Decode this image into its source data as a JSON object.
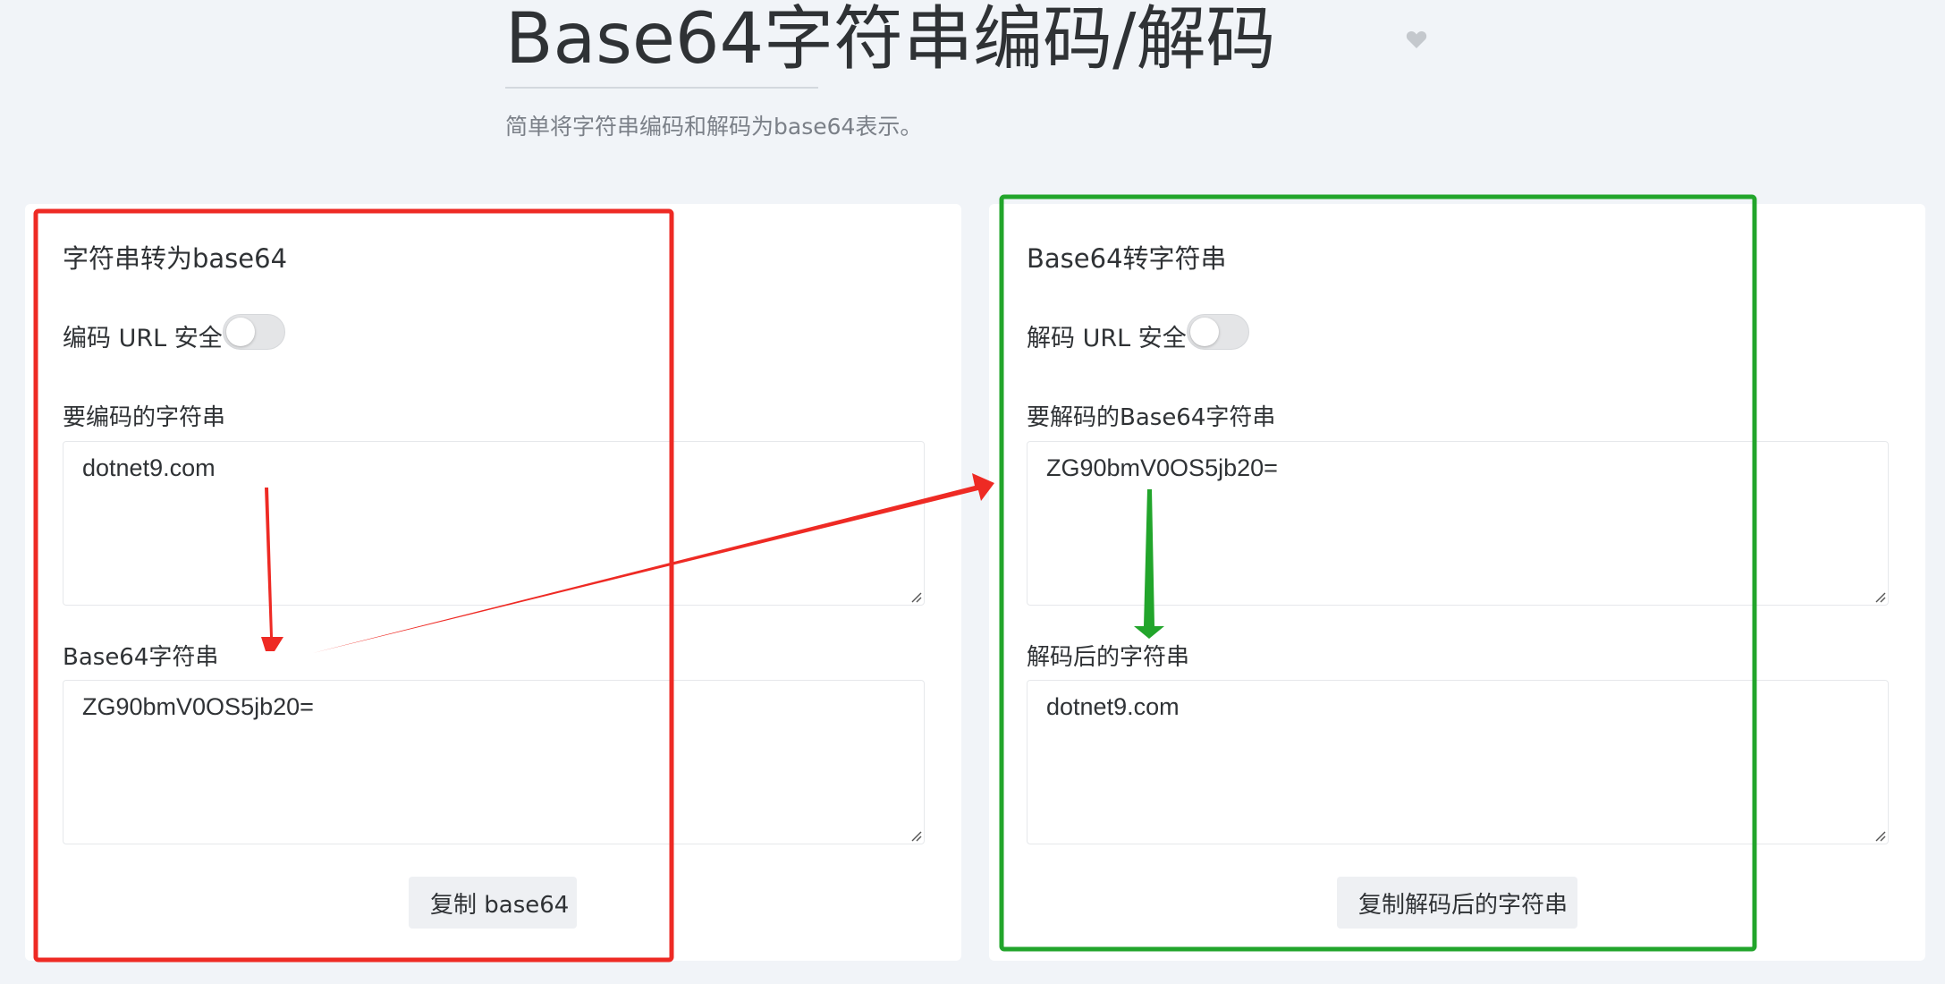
{
  "page": {
    "title": "Base64字符串编码/解码",
    "subtitle": "简单将字符串编码和解码为base64表示。"
  },
  "encode_panel": {
    "title": "字符串转为base64",
    "toggle_label": "编码 URL 安全",
    "toggle_on": false,
    "input_label": "要编码的字符串",
    "input_value": "dotnet9.com",
    "output_label": "Base64字符串",
    "output_value": "ZG90bmV0OS5jb20=",
    "copy_label": "复制 base64"
  },
  "decode_panel": {
    "title": "Base64转字符串",
    "toggle_label": "解码 URL 安全",
    "toggle_on": false,
    "input_label": "要解码的Base64字符串",
    "input_value": "ZG90bmV0OS5jb20=",
    "output_label": "解码后的字符串",
    "output_value": "dotnet9.com",
    "copy_label": "复制解码后的字符串"
  },
  "annotations": {
    "red": "#ee2a24",
    "green": "#22a52b"
  },
  "icons": [
    "heart-icon",
    "resize-handle-icon"
  ]
}
